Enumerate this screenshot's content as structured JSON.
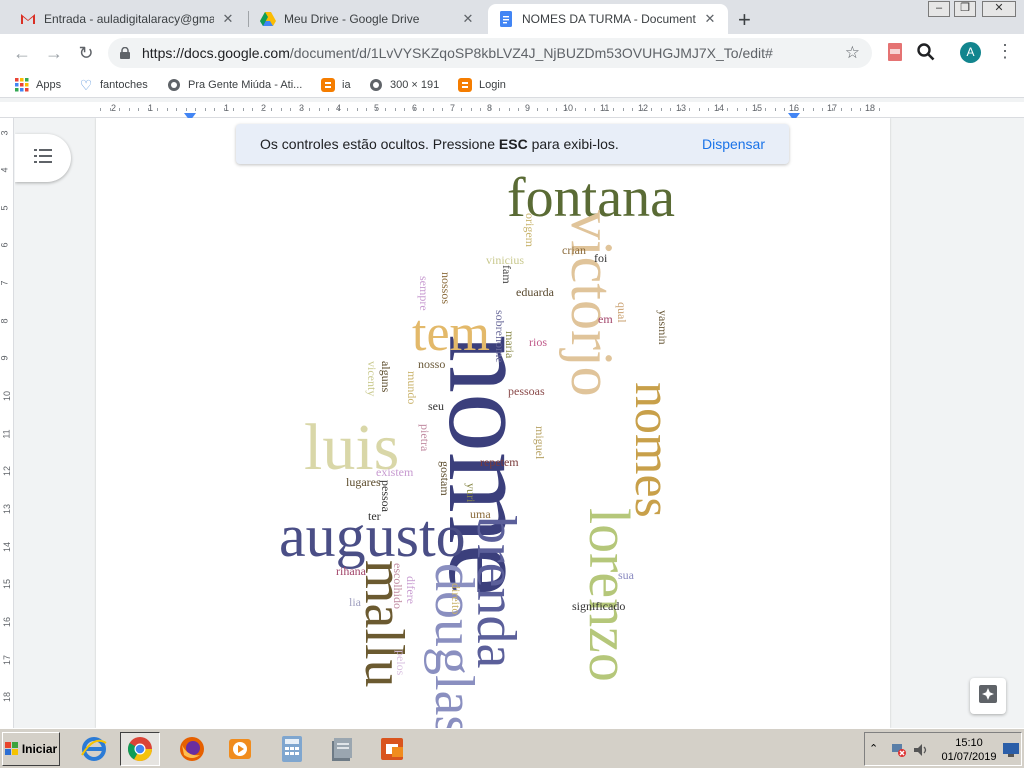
{
  "tabs": [
    {
      "title": "Entrada - auladigitalaracy@gmail.com",
      "icon": "gmail-icon",
      "close": "✕"
    },
    {
      "title": "Meu Drive - Google Drive",
      "icon": "google-drive-icon",
      "close": "✕"
    },
    {
      "title": "NOMES DA TURMA - Documentos Google",
      "icon": "docs-icon",
      "close": "✕"
    }
  ],
  "new_tab": "+",
  "toolbar": {
    "url_host": "https://docs.google.com",
    "url_path": "/document/d/1LvVYSKZqoSP8kbLVZ4J_NjBUZDm53OVUHGJMJ7X_To/edit#",
    "avatar_letter": "A"
  },
  "bookmarks": [
    {
      "label": "Apps",
      "icon": "apps-grid-icon"
    },
    {
      "label": "fantoches",
      "icon": "heart-icon"
    },
    {
      "label": "Pra Gente Miúda - Ati...",
      "icon": "globe-icon"
    },
    {
      "label": "ia",
      "icon": "blogger-icon"
    },
    {
      "label": "300 × 191",
      "icon": "globe-icon"
    },
    {
      "label": "Login",
      "icon": "blogger-icon"
    }
  ],
  "ruler": {
    "marks": [
      "2",
      "1",
      "",
      "1",
      "2",
      "3",
      "4",
      "5",
      "6",
      "7",
      "8",
      "9",
      "10",
      "11",
      "12",
      "13",
      "14",
      "15",
      "16",
      "17",
      "18"
    ],
    "vertical_marks": [
      "3",
      "4",
      "5",
      "6",
      "7",
      "8",
      "9",
      "10",
      "11",
      "12",
      "13",
      "14",
      "15",
      "16",
      "17",
      "18"
    ]
  },
  "toast": {
    "before": "Os controles estão ocultos. Pressione ",
    "key": "ESC",
    "after": " para exibi-los.",
    "dismiss": "Dispensar"
  },
  "word_cloud": [
    {
      "text": "nome",
      "color": "#3b3f7c"
    },
    {
      "text": "fontana",
      "color": "#5a6b35"
    },
    {
      "text": "victorjo",
      "color": "#e0c49a"
    },
    {
      "text": "nomes",
      "color": "#c8a04a"
    },
    {
      "text": "tem",
      "color": "#e3b96a"
    },
    {
      "text": "luis",
      "color": "#d9d7a8"
    },
    {
      "text": "augusto",
      "color": "#4a4e86"
    },
    {
      "text": "brenda",
      "color": "#5b5f9a"
    },
    {
      "text": "douglas",
      "color": "#8a8fc0"
    },
    {
      "text": "mallu",
      "color": "#6b5a30"
    },
    {
      "text": "lorenzo",
      "color": "#b5c77a"
    },
    {
      "text": "origem",
      "color": "#c7b26a"
    },
    {
      "text": "crian",
      "color": "#8a6a3a"
    },
    {
      "text": "foi",
      "color": "#333333"
    },
    {
      "text": "vinicius",
      "color": "#c9c98e"
    },
    {
      "text": "fam",
      "color": "#444444"
    },
    {
      "text": "eduarda",
      "color": "#5a4a30"
    },
    {
      "text": "nossos",
      "color": "#8a6a3a"
    },
    {
      "text": "sempre",
      "color": "#c79ad0"
    },
    {
      "text": "qual",
      "color": "#c9a070"
    },
    {
      "text": "yasmin",
      "color": "#6a5a3a"
    },
    {
      "text": "em",
      "color": "#a2456a"
    },
    {
      "text": "sobrenome",
      "color": "#6a6a9a"
    },
    {
      "text": "maria",
      "color": "#8a8a4a"
    },
    {
      "text": "rios",
      "color": "#c05a8a"
    },
    {
      "text": "nosso",
      "color": "#6b5a3a"
    },
    {
      "text": "alguns",
      "color": "#5a4a2a"
    },
    {
      "text": "mundo",
      "color": "#c9b26a"
    },
    {
      "text": "vicenty",
      "color": "#c9c98e"
    },
    {
      "text": "pessoas",
      "color": "#8a4a4a"
    },
    {
      "text": "seu",
      "color": "#333333"
    },
    {
      "text": "pietra",
      "color": "#c08aa0"
    },
    {
      "text": "miguel",
      "color": "#b5a060"
    },
    {
      "text": "repetem",
      "color": "#7a3a3a"
    },
    {
      "text": "existem",
      "color": "#c79ad0"
    },
    {
      "text": "gostam",
      "color": "#5a4a2a"
    },
    {
      "text": "lugares",
      "color": "#5a4a2a"
    },
    {
      "text": "pessoa",
      "color": "#333333"
    },
    {
      "text": "yuri",
      "color": "#8a8a4a"
    },
    {
      "text": "uma",
      "color": "#8a6a3a"
    },
    {
      "text": "ter",
      "color": "#333333"
    },
    {
      "text": "rihana",
      "color": "#a2456a"
    },
    {
      "text": "escolhido",
      "color": "#c08aa0"
    },
    {
      "text": "difere",
      "color": "#c79ad0"
    },
    {
      "text": "direito",
      "color": "#c9b26a"
    },
    {
      "text": "sua",
      "color": "#8a8ac0"
    },
    {
      "text": "lia",
      "color": "#a0a0c0"
    },
    {
      "text": "significado",
      "color": "#333333"
    },
    {
      "text": "pelos",
      "color": "#d9c0e0"
    }
  ],
  "taskbar": {
    "start_label": "Iniciar",
    "apps": [
      "internet-explorer-icon",
      "chrome-icon",
      "firefox-icon",
      "media-player-icon",
      "calculator-icon",
      "files-icon",
      "presentation-icon"
    ],
    "time": "15:10",
    "date": "01/07/2019"
  }
}
